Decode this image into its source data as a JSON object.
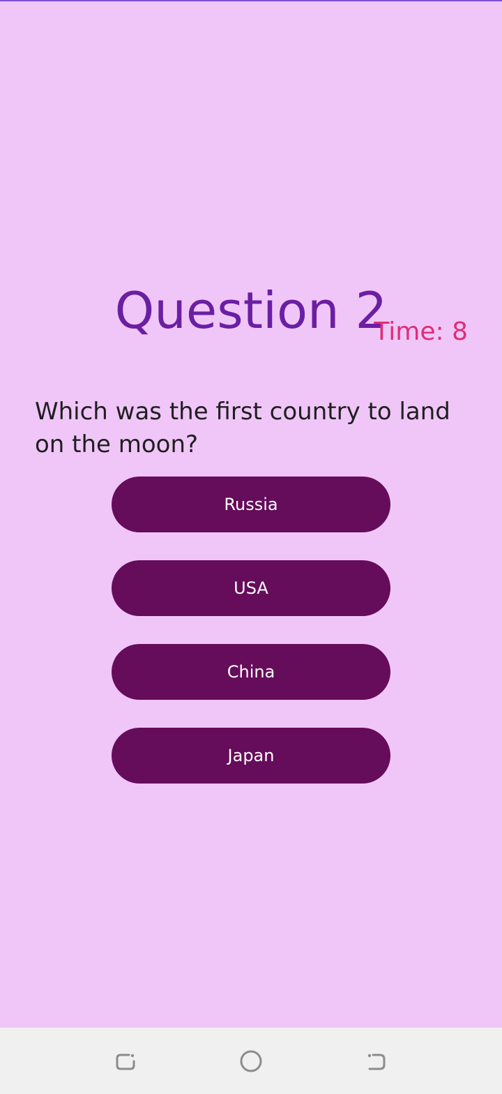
{
  "quiz": {
    "title": "Question 2",
    "timer": "Time: 8",
    "question": "Which was the first country to land on the moon?",
    "answers": [
      {
        "label": "Russia"
      },
      {
        "label": "USA"
      },
      {
        "label": "China"
      },
      {
        "label": "Japan"
      }
    ]
  },
  "nav": {
    "icons": [
      "recent-apps-icon",
      "home-icon",
      "back-icon"
    ]
  },
  "colors": {
    "background": "#f0c6f8",
    "title": "#6a1fa3",
    "timer": "#e02d74",
    "button": "#650c5a",
    "button_text": "#ffffff",
    "nav_bar": "#f0f0f0"
  }
}
